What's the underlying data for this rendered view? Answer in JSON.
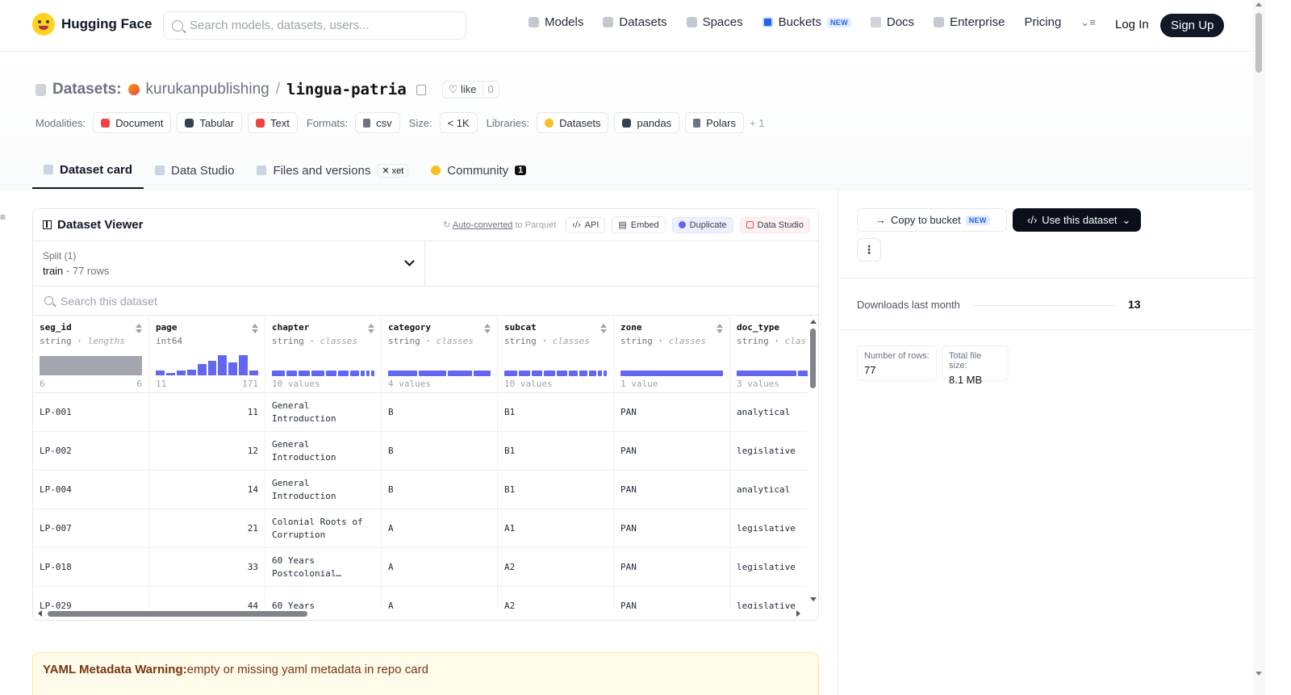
{
  "nav": {
    "brand": "Hugging Face",
    "search_placeholder": "Search models, datasets, users...",
    "links": [
      {
        "label": "Models",
        "icon": "cube-icon"
      },
      {
        "label": "Datasets",
        "icon": "database-icon"
      },
      {
        "label": "Spaces",
        "icon": "grid-icon"
      },
      {
        "label": "Buckets",
        "icon": "bucket-icon",
        "badge": "NEW"
      },
      {
        "label": "Docs",
        "icon": "book-icon"
      },
      {
        "label": "Enterprise",
        "icon": "enterprise-icon"
      },
      {
        "label": "Pricing"
      }
    ],
    "login": "Log In",
    "signup": "Sign Up"
  },
  "repo": {
    "type_label": "Datasets:",
    "org": "kurukanpublishing",
    "slash": "/",
    "name": "lingua-patria",
    "like_label": "like",
    "like_count": "0"
  },
  "tags": {
    "modalities_label": "Modalities:",
    "modalities": [
      "Document",
      "Tabular",
      "Text"
    ],
    "formats_label": "Formats:",
    "formats": [
      "csv"
    ],
    "size_label": "Size:",
    "size": "< 1K",
    "libraries_label": "Libraries:",
    "libraries": [
      "Datasets",
      "pandas",
      "Polars"
    ],
    "more": "+ 1"
  },
  "tabs": [
    {
      "label": "Dataset card",
      "active": true
    },
    {
      "label": "Data Studio"
    },
    {
      "label": "Files and versions",
      "badge": "xet"
    },
    {
      "label": "Community",
      "count": "1"
    }
  ],
  "viewer": {
    "title": "Dataset Viewer",
    "auto_converted": "Auto-converted",
    "auto_converted_suffix": " to Parquet",
    "api": "API",
    "embed": "Embed",
    "duplicate": "Duplicate",
    "data_studio": "Data Studio",
    "split_label": "Split (1)",
    "split_value": "train",
    "split_rows": "77 rows",
    "search_placeholder": "Search this dataset",
    "columns": [
      {
        "name": "seg_id",
        "type": "string",
        "stat": "lengths",
        "foot_left": "6",
        "foot_right": "6"
      },
      {
        "name": "page",
        "type": "int64",
        "stat": "",
        "foot_left": "11",
        "foot_right": "171"
      },
      {
        "name": "chapter",
        "type": "string",
        "stat": "classes",
        "foot_left": "10 values",
        "foot_right": ""
      },
      {
        "name": "category",
        "type": "string",
        "stat": "classes",
        "foot_left": "4 values",
        "foot_right": ""
      },
      {
        "name": "subcat",
        "type": "string",
        "stat": "classes",
        "foot_left": "10 values",
        "foot_right": ""
      },
      {
        "name": "zone",
        "type": "string",
        "stat": "classes",
        "foot_left": "1 value",
        "foot_right": ""
      },
      {
        "name": "doc_type",
        "type": "string",
        "stat": "clas",
        "foot_left": "3 values",
        "foot_right": ""
      }
    ],
    "page_histogram": [
      0.25,
      0.12,
      0.22,
      0.28,
      0.55,
      0.7,
      0.95,
      0.6,
      0.95,
      0.22
    ],
    "rows": [
      [
        "LP-001",
        "11",
        "General Introduction",
        "B",
        "B1",
        "PAN",
        "analytical"
      ],
      [
        "LP-002",
        "12",
        "General Introduction",
        "B",
        "B1",
        "PAN",
        "legislative"
      ],
      [
        "LP-004",
        "14",
        "General Introduction",
        "B",
        "B1",
        "PAN",
        "analytical"
      ],
      [
        "LP-007",
        "21",
        "Colonial Roots of Corruption",
        "A",
        "A1",
        "PAN",
        "legislative"
      ],
      [
        "LP-018",
        "33",
        "60 Years Postcolonial…",
        "A",
        "A2",
        "PAN",
        "legislative"
      ],
      [
        "LP-029",
        "44",
        "60 Years",
        "A",
        "A2",
        "PAN",
        "legislative"
      ]
    ]
  },
  "sidebar": {
    "copy_to_bucket": "Copy to bucket",
    "copy_badge": "NEW",
    "use_dataset": "Use this dataset",
    "downloads_label": "Downloads last month",
    "downloads_value": "13",
    "rows_label": "Number of rows:",
    "rows_value": "77",
    "size_label": "Total file size:",
    "size_value": "8.1 MB"
  },
  "warning": {
    "title": "YAML Metadata Warning:",
    "text": "empty or missing yaml metadata in repo card"
  },
  "colors": {
    "accent": "#6366f1",
    "dark": "#111827",
    "warning_bg": "#fffbeb"
  }
}
